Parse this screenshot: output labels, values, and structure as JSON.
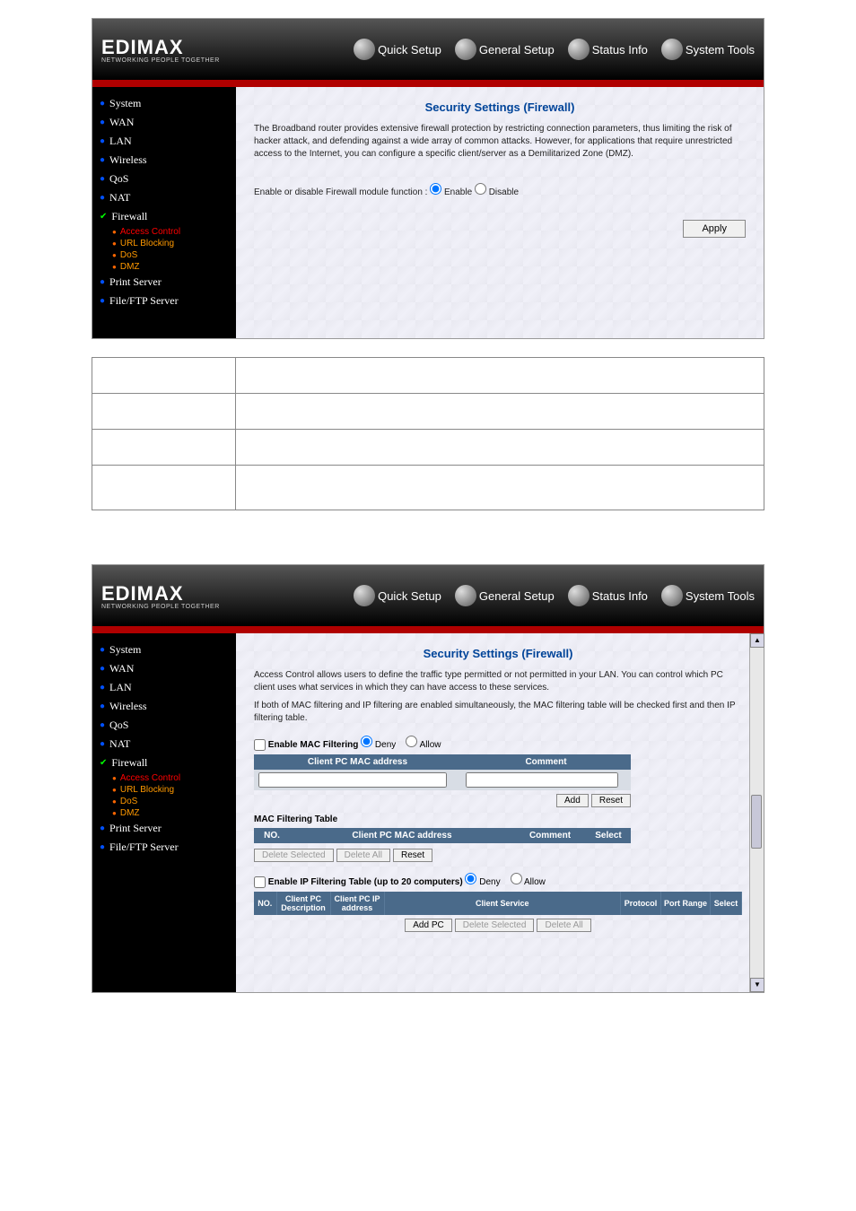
{
  "logo": {
    "name": "EDIMAX",
    "tagline": "NETWORKING PEOPLE TOGETHER"
  },
  "topnav": [
    {
      "label": "Quick Setup"
    },
    {
      "label": "General Setup"
    },
    {
      "label": "Status Info"
    },
    {
      "label": "System Tools"
    }
  ],
  "sidebar": [
    {
      "label": "System"
    },
    {
      "label": "WAN"
    },
    {
      "label": "LAN"
    },
    {
      "label": "Wireless"
    },
    {
      "label": "QoS"
    },
    {
      "label": "NAT"
    },
    {
      "label": "Firewall",
      "active": true,
      "subs": [
        {
          "label": "Access Control",
          "active": true
        },
        {
          "label": "URL Blocking"
        },
        {
          "label": "DoS"
        },
        {
          "label": "DMZ"
        }
      ]
    },
    {
      "label": "Print Server"
    },
    {
      "label": "File/FTP Server"
    }
  ],
  "panel1": {
    "title": "Security Settings (Firewall)",
    "intro": "The Broadband router provides extensive firewall protection by restricting connection parameters, thus limiting the risk of hacker attack, and defending against a wide array of common attacks. However, for applications that require unrestricted access to the Internet, you can configure a specific client/server as a Demilitarized Zone (DMZ).",
    "module_label": "Enable or disable Firewall module function :",
    "enable": "Enable",
    "disable": "Disable",
    "apply": "Apply"
  },
  "panel2": {
    "title": "Security Settings (Firewall)",
    "intro1": "Access Control allows users to define the traffic type permitted or not permitted in your LAN. You can control which PC client uses what services in which they can have access to these services.",
    "intro2": "If both of MAC filtering and IP filtering are enabled simultaneously, the MAC filtering table will be checked first and then IP filtering table.",
    "mac_enable": "Enable MAC Filtering",
    "deny": "Deny",
    "allow": "Allow",
    "mac_hdr": {
      "addr": "Client PC MAC address",
      "comment": "Comment"
    },
    "add": "Add",
    "reset": "Reset",
    "mac_table_label": "MAC Filtering Table",
    "mac_table_hdr": {
      "no": "NO.",
      "addr": "Client PC MAC address",
      "comment": "Comment",
      "select": "Select"
    },
    "delete_selected": "Delete Selected",
    "delete_all": "Delete All",
    "ip_enable": "Enable IP Filtering Table (up to 20 computers)",
    "ip_hdr": {
      "no": "NO.",
      "desc": "Client PC Description",
      "ip": "Client PC IP address",
      "service": "Client Service",
      "protocol": "Protocol",
      "port": "Port Range",
      "select": "Select"
    },
    "add_pc": "Add PC"
  }
}
